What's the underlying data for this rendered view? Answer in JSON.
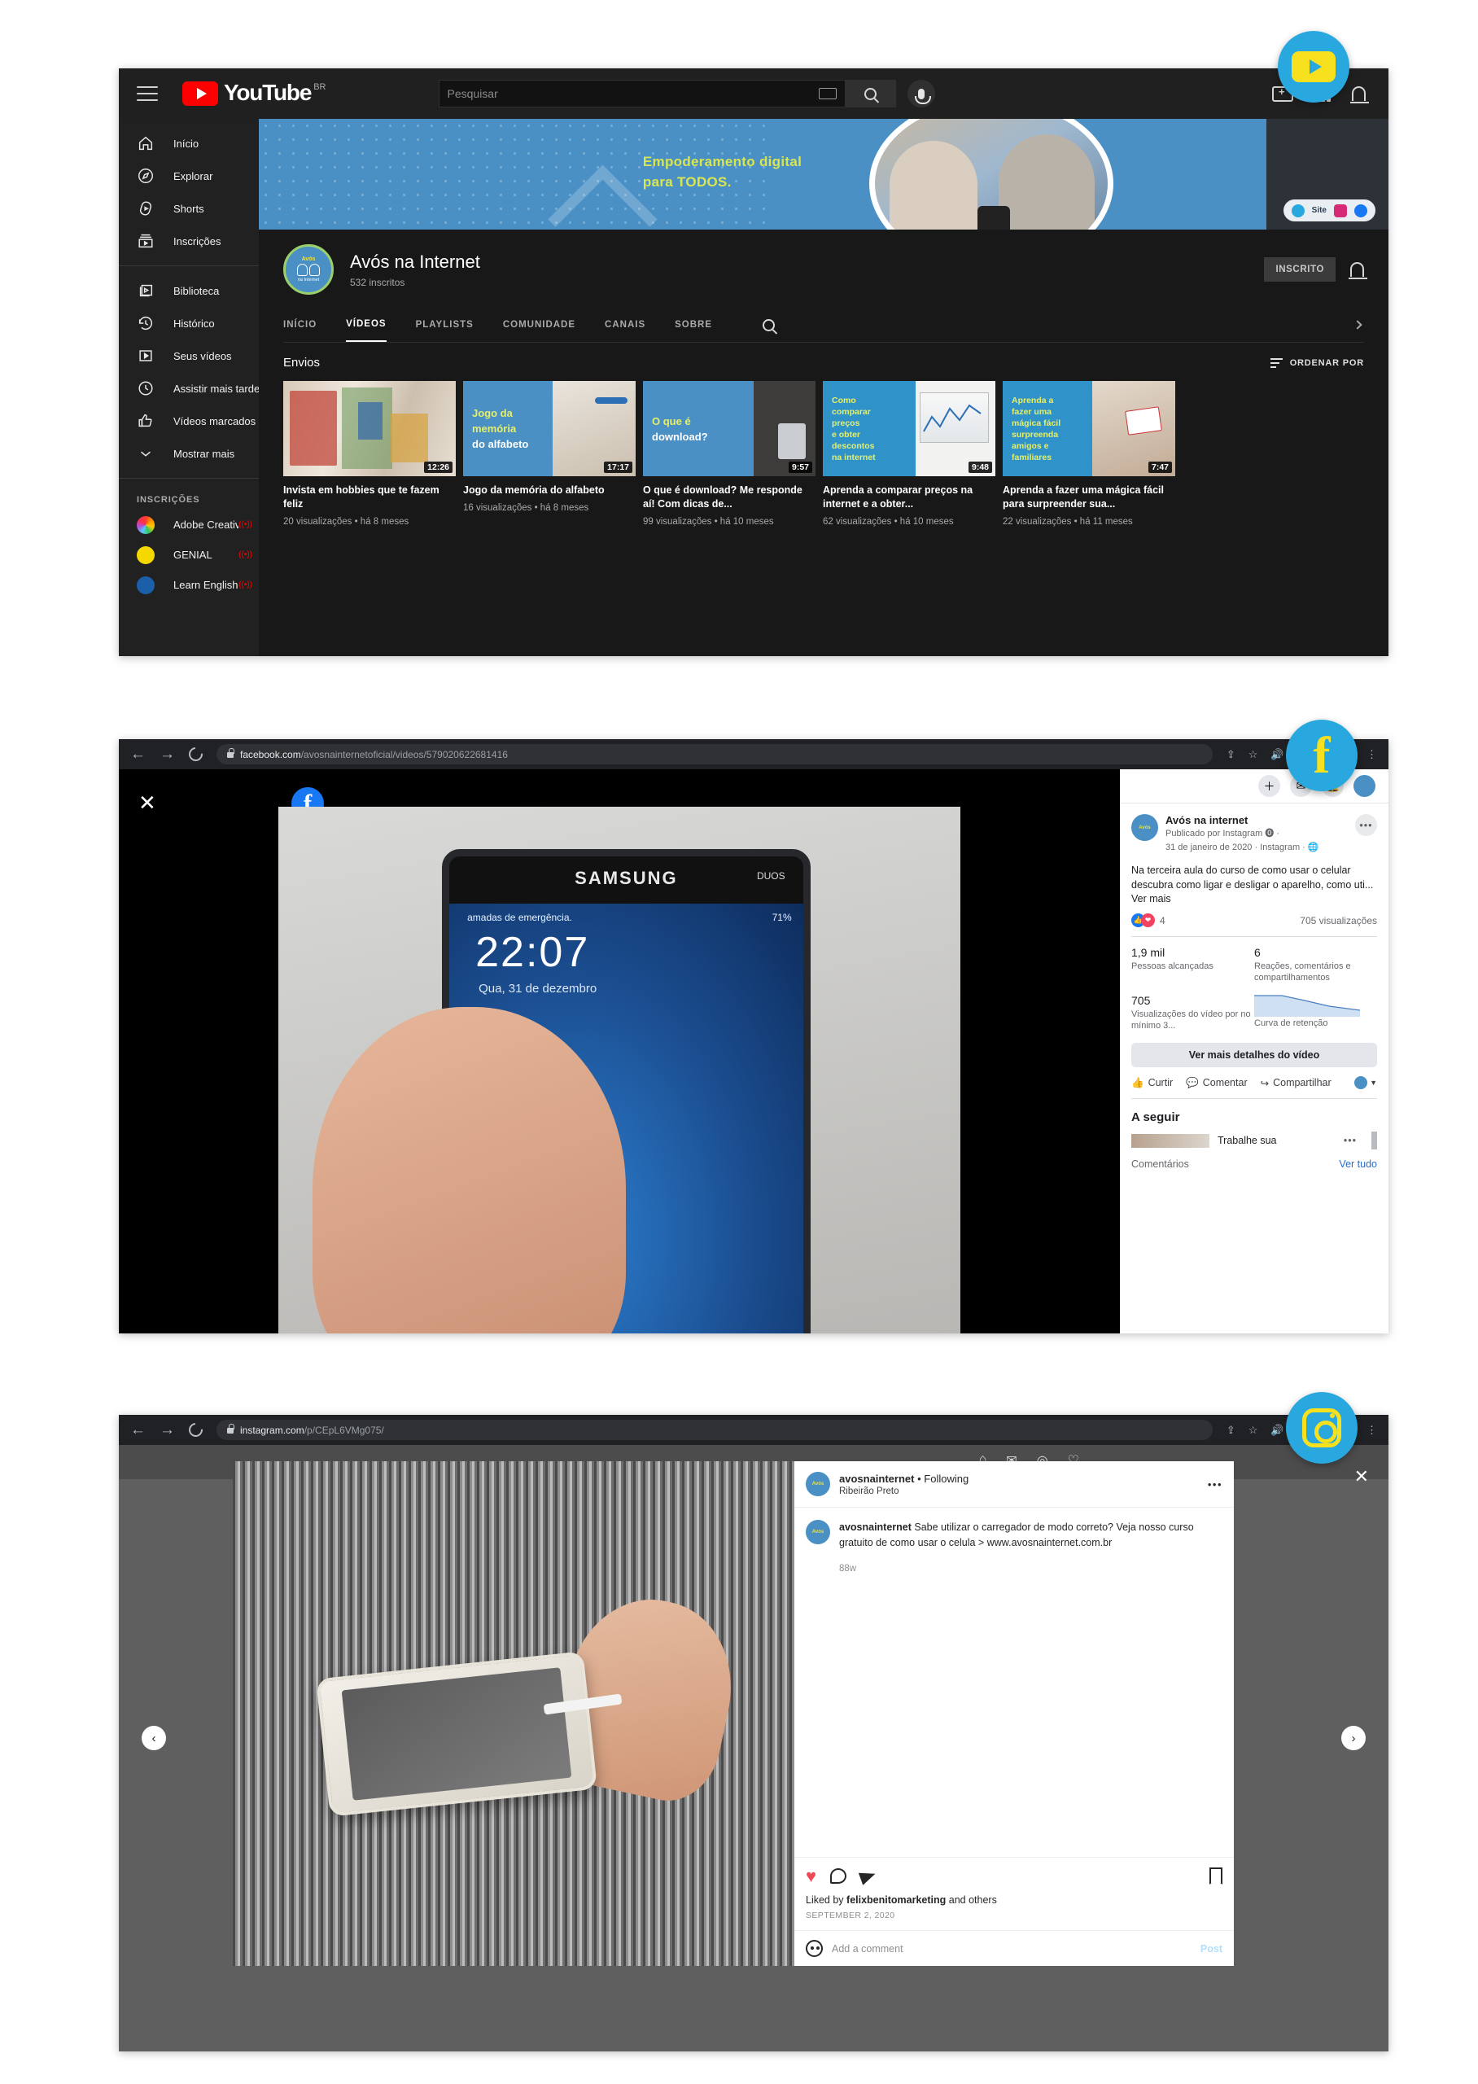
{
  "youtube": {
    "logo_word": "YouTube",
    "country_code": "BR",
    "search_placeholder": "Pesquisar",
    "sidebar": {
      "primary": [
        {
          "label": "Início",
          "icon": "home-icon"
        },
        {
          "label": "Explorar",
          "icon": "compass-icon"
        },
        {
          "label": "Shorts",
          "icon": "shorts-icon"
        },
        {
          "label": "Inscrições",
          "icon": "subscriptions-icon"
        }
      ],
      "secondary": [
        {
          "label": "Biblioteca",
          "icon": "library-icon"
        },
        {
          "label": "Histórico",
          "icon": "history-icon"
        },
        {
          "label": "Seus vídeos",
          "icon": "your-videos-icon"
        },
        {
          "label": "Assistir mais tarde",
          "icon": "clock-icon"
        },
        {
          "label": "Vídeos marcados co...",
          "icon": "thumbs-up-icon"
        },
        {
          "label": "Mostrar mais",
          "icon": "chevron-down-icon"
        }
      ],
      "subscriptions_title": "INSCRIÇÕES",
      "subscriptions": [
        {
          "label": "Adobe Creative Clo...",
          "color": "#e8534f",
          "live": true
        },
        {
          "label": "GENIAL",
          "color": "#f5d800",
          "live": true
        },
        {
          "label": "Learn English with",
          "color": "#1b5fa8",
          "live": true
        }
      ]
    },
    "banner": {
      "headline_line1": "Empoderamento digital",
      "headline_line2": "para TODOS.",
      "social_label": "Site"
    },
    "channel": {
      "name": "Avós na Internet",
      "subscribers": "532 inscritos",
      "subscribe_button": "INSCRITO",
      "avatar_top": "Avós",
      "avatar_bottom": "na Internet"
    },
    "tabs": [
      {
        "label": "INÍCIO",
        "active": false
      },
      {
        "label": "VÍDEOS",
        "active": true
      },
      {
        "label": "PLAYLISTS",
        "active": false
      },
      {
        "label": "COMUNIDADE",
        "active": false
      },
      {
        "label": "CANAIS",
        "active": false
      },
      {
        "label": "SOBRE",
        "active": false
      }
    ],
    "uploads_title": "Envios",
    "sort_label": "ORDENAR POR",
    "videos": [
      {
        "title": "Invista em hobbies que te fazem feliz",
        "meta": "20 visualizações • há 8 meses",
        "duration": "12:26",
        "thumb_text": "",
        "thumb_kind": "photo-drawings"
      },
      {
        "title": "Jogo da memória do alfabeto",
        "meta": "16 visualizações • há 8 meses",
        "duration": "17:17",
        "thumb_text": "Jogo da\nmemória\ndo alfabeto",
        "thumb_kind": "text-blue"
      },
      {
        "title": "O que é download? Me responde aí! Com dicas de...",
        "meta": "99 visualizações • há 10 meses",
        "duration": "9:57",
        "thumb_text": "O que é\ndownload?",
        "thumb_kind": "text-blue"
      },
      {
        "title": "Aprenda a comparar preços na internet e a obter...",
        "meta": "62 visualizações • há 10 meses",
        "duration": "9:48",
        "thumb_text": "Como\ncomparar\npreços\ne obter\ndescontos\nna internet",
        "thumb_kind": "text-blue-chart"
      },
      {
        "title": "Aprenda a fazer uma mágica fácil para surpreender sua...",
        "meta": "22 visualizações • há 11 meses",
        "duration": "7:47",
        "thumb_text": "Aprenda a\nfazer uma\nmágica fácil\nsurpreenda\namigos e\nfamiliares",
        "thumb_kind": "text-blue-cards"
      }
    ]
  },
  "facebook": {
    "url_domain": "facebook.com",
    "url_path": "/avosnainternetoficial/videos/579020622681416",
    "logo_letter": "f",
    "post": {
      "page_name": "Avós na internet",
      "published_by": "Publicado por Instagram 🄌 ·",
      "date_line": "31 de janeiro de 2020 · Instagram · 🌐",
      "text": "Na terceira aula do curso de como usar o celular descubra como ligar e desligar o aparelho, como uti...",
      "see_more": "Ver mais",
      "reaction_count": "4",
      "views": "705 visualizações",
      "more_menu": "•••"
    },
    "stats": [
      {
        "number": "1,9 mil",
        "label": "Pessoas alcançadas"
      },
      {
        "number": "6",
        "label": "Reações, comentários e compartilhamentos"
      },
      {
        "number": "705",
        "label": "Visualizações do vídeo por no mínimo 3..."
      }
    ],
    "retention_label": "Curva de retenção",
    "details_button": "Ver mais detalhes do vídeo",
    "actions": [
      {
        "label": "Curtir",
        "icon": "thumbs-up-icon"
      },
      {
        "label": "Comentar",
        "icon": "comment-icon"
      },
      {
        "label": "Compartilhar",
        "icon": "share-icon"
      }
    ],
    "next_title": "A seguir",
    "next_item": "Trabalhe sua",
    "comments_label": "Comentários",
    "comments_see_all": "Ver tudo",
    "phone": {
      "brand": "SAMSUNG",
      "duos": "DUOS",
      "status_left": "amadas de emergência.",
      "status_right": "71%",
      "time": "22:07",
      "date": "Qua, 31 de dezembro"
    }
  },
  "instagram": {
    "url_domain": "instagram.com",
    "url_path": "/p/CEpL6VMg075/",
    "post": {
      "username": "avosnainternet",
      "following": "• Following",
      "location": "Ribeirão Preto",
      "more_menu": "•••",
      "caption_user": "avosnainternet",
      "caption_text": " Sabe utilizar o carregador de modo correto? Veja nosso curso gratuito de como usar o celula > www.avosnainternet.com.br",
      "time_ago": "88w",
      "liked_by_prefix": "Liked by ",
      "liked_by_user": "felixbenitomarketing",
      "liked_by_suffix": " and others",
      "date": "SEPTEMBER 2, 2020",
      "add_comment_placeholder": "Add a comment",
      "post_button": "Post"
    },
    "prev_arrow": "‹",
    "next_arrow": "›",
    "close": "✕"
  },
  "browser": {
    "back": "←",
    "forward": "→",
    "reload_icon": "reload-icon"
  },
  "badges": {
    "youtube": "youtube-badge-icon",
    "facebook": "f",
    "instagram": "instagram-badge-icon"
  },
  "colors": {
    "youtube_red": "#ff0000",
    "facebook_blue": "#1877f2",
    "instagram_pink": "#ed4956",
    "brand_blue": "#29a8df",
    "brand_yellow": "#f7e11f",
    "banner_blue": "#4a90c4"
  }
}
